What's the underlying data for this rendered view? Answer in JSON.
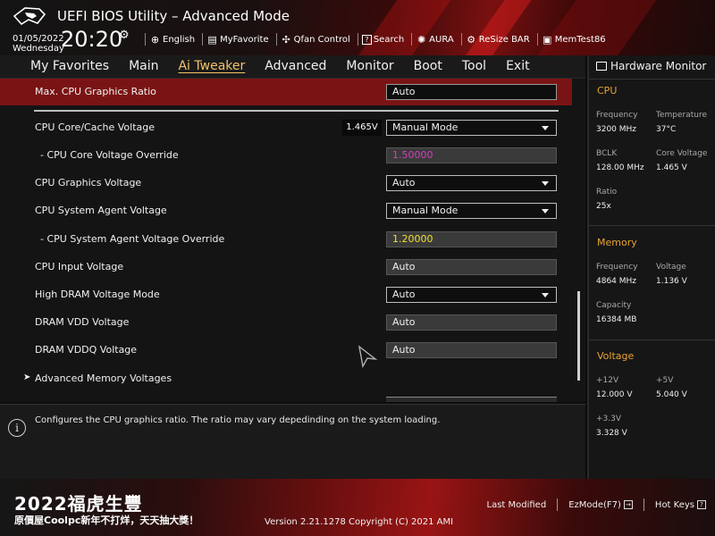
{
  "header": {
    "title": "UEFI BIOS Utility – Advanced Mode",
    "date": "01/05/2022",
    "weekday": "Wednesday",
    "time": "20:20",
    "toolbar": [
      {
        "icon": "globe-icon",
        "glyph": "⊕",
        "label": "English"
      },
      {
        "icon": "favorite-icon",
        "glyph": "▤",
        "label": "MyFavorite"
      },
      {
        "icon": "fan-icon",
        "glyph": "✣",
        "label": "Qfan Control"
      },
      {
        "icon": "help-icon",
        "glyph": "?",
        "label": "Search"
      },
      {
        "icon": "aura-icon",
        "glyph": "✺",
        "label": "AURA"
      },
      {
        "icon": "resize-bar-icon",
        "glyph": "⚙",
        "label": "ReSize BAR"
      },
      {
        "icon": "memtest-icon",
        "glyph": "▣",
        "label": "MemTest86"
      }
    ]
  },
  "nav": {
    "tabs": [
      {
        "label": "My Favorites",
        "active": false
      },
      {
        "label": "Main",
        "active": false
      },
      {
        "label": "Ai Tweaker",
        "active": true
      },
      {
        "label": "Advanced",
        "active": false
      },
      {
        "label": "Monitor",
        "active": false
      },
      {
        "label": "Boot",
        "active": false
      },
      {
        "label": "Tool",
        "active": false
      },
      {
        "label": "Exit",
        "active": false
      }
    ]
  },
  "settings": [
    {
      "label": "Max. CPU Graphics Ratio",
      "value": "Auto",
      "kind": "text",
      "highlight": true,
      "sub": false
    },
    {
      "label": "CPU Core/Cache Voltage",
      "value": "Manual Mode",
      "kind": "dropdown",
      "readout": "1.465V",
      "sub": false
    },
    {
      "label": "- CPU Core Voltage Override",
      "value": "1.50000",
      "kind": "readonly",
      "value_color": "#d43fc0",
      "sub": true
    },
    {
      "label": "CPU Graphics Voltage",
      "value": "Auto",
      "kind": "dropdown",
      "sub": false
    },
    {
      "label": "CPU System Agent Voltage",
      "value": "Manual Mode",
      "kind": "dropdown",
      "sub": false
    },
    {
      "label": "- CPU System Agent Voltage Override",
      "value": "1.20000",
      "kind": "readonly",
      "value_color": "#f0e030",
      "sub": true
    },
    {
      "label": "CPU Input Voltage",
      "value": "Auto",
      "kind": "grey",
      "sub": false
    },
    {
      "label": "High DRAM Voltage Mode",
      "value": "Auto",
      "kind": "dropdown",
      "sub": false
    },
    {
      "label": "DRAM VDD Voltage",
      "value": "Auto",
      "kind": "grey",
      "sub": false
    },
    {
      "label": "DRAM VDDQ Voltage",
      "value": "Auto",
      "kind": "grey",
      "sub": false
    },
    {
      "label": "Advanced Memory Voltages",
      "kind": "submenu",
      "sub": false
    }
  ],
  "help": {
    "text": "Configures the CPU graphics ratio. The ratio may vary depedinding on the system loading."
  },
  "hardware_monitor": {
    "title": "Hardware Monitor",
    "cpu": {
      "heading": "CPU",
      "frequency_label": "Frequency",
      "frequency": "3200 MHz",
      "temperature_label": "Temperature",
      "temperature": "37°C",
      "bclk_label": "BCLK",
      "bclk": "128.00 MHz",
      "core_voltage_label": "Core Voltage",
      "core_voltage": "1.465 V",
      "ratio_label": "Ratio",
      "ratio": "25x"
    },
    "memory": {
      "heading": "Memory",
      "frequency_label": "Frequency",
      "frequency": "4864 MHz",
      "voltage_label": "Voltage",
      "voltage": "1.136 V",
      "capacity_label": "Capacity",
      "capacity": "16384 MB"
    },
    "voltage": {
      "heading": "Voltage",
      "v12_label": "+12V",
      "v12": "12.000 V",
      "v5_label": "+5V",
      "v5": "5.040 V",
      "v33_label": "+3.3V",
      "v33": "3.328 V"
    }
  },
  "footer": {
    "promo_line1": "2022福虎生豐",
    "promo_line2": "原價屋Coolpc新年不打烊，天天抽大獎！",
    "version": "Version 2.21.1278 Copyright (C) 2021 AMI",
    "last_modified": "Last Modified",
    "ezmode": "EzMode(F7)",
    "hotkeys": "Hot Keys"
  },
  "colors": {
    "accent": "#f4c36a",
    "section": "#e8a230",
    "highlight_row": "#7a1414"
  }
}
